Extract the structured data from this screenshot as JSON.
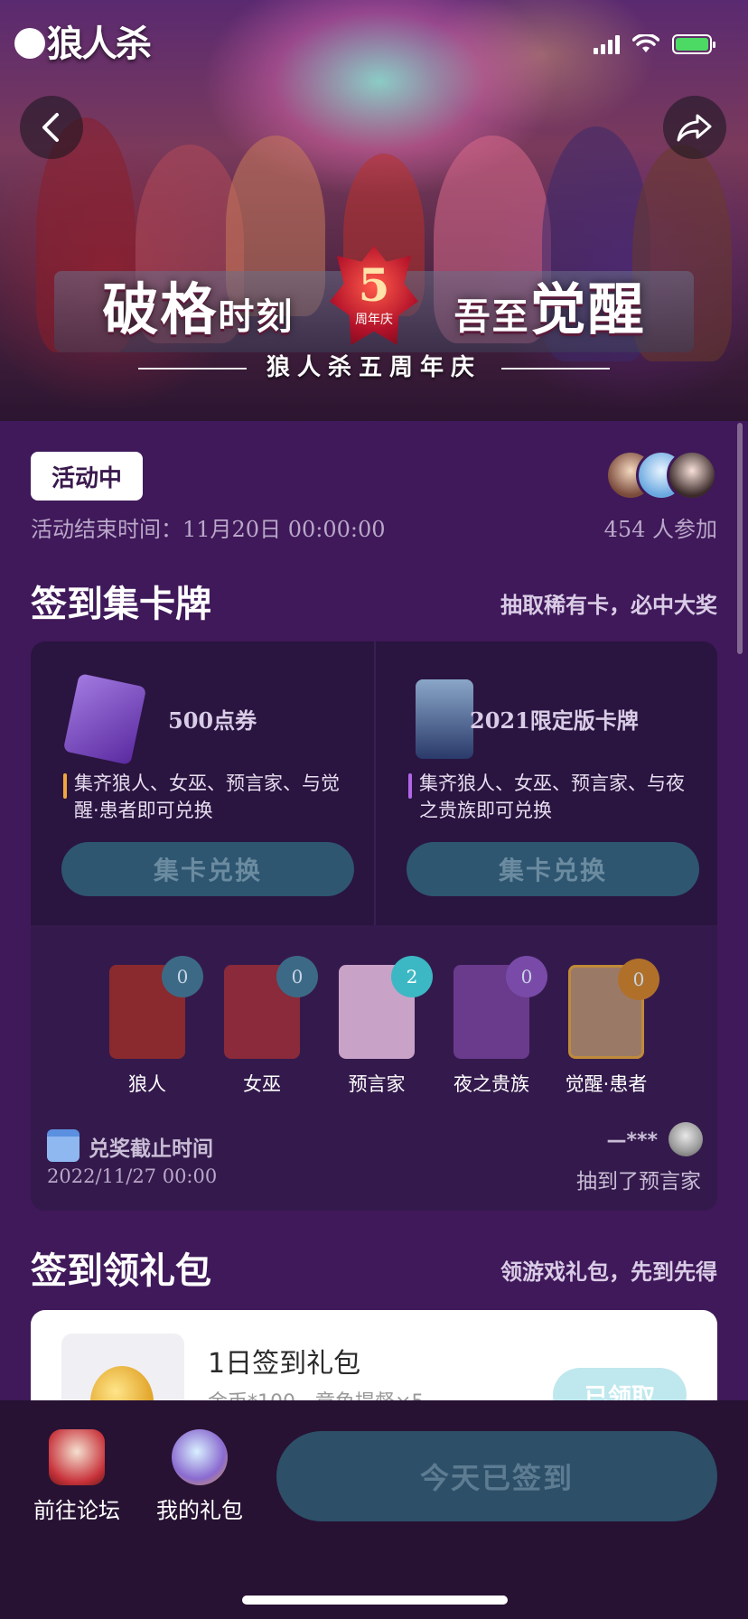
{
  "app": {
    "logo_text": "狼人杀"
  },
  "hero": {
    "title_left_big": "破格",
    "title_left_small": "时刻",
    "title_right_small": "吾至",
    "title_right_big": "觉醒",
    "badge_number": "5",
    "badge_label": "周年庆",
    "subtitle": "狼人杀五周年庆"
  },
  "activity": {
    "status": "活动中",
    "end_time_label": "活动结束时间：",
    "end_time_value": "11月20日 00:00:00",
    "participants": "454 人参加"
  },
  "card_section": {
    "title": "签到集卡牌",
    "subtitle": "抽取稀有卡，必中大奖",
    "rewards": [
      {
        "name": "500点券",
        "desc": "集齐狼人、女巫、预言家、与觉醒·患者即可兑换",
        "button": "集卡兑换"
      },
      {
        "name": "2021限定版卡牌",
        "desc": "集齐狼人、女巫、预言家、与夜之贵族即可兑换",
        "button": "集卡兑换"
      }
    ],
    "cards": [
      {
        "label": "狼人",
        "count": "0",
        "bg": "#8a2a2e",
        "badge": "#3c6a86"
      },
      {
        "label": "女巫",
        "count": "0",
        "bg": "#8a2a3a",
        "badge": "#3c6a86"
      },
      {
        "label": "预言家",
        "count": "2",
        "bg": "#c9a2c8",
        "badge": "#3cb8c4"
      },
      {
        "label": "夜之贵族",
        "count": "0",
        "bg": "#6a3a8c",
        "badge": "#7a4aa8"
      },
      {
        "label": "觉醒·患者",
        "count": "0",
        "bg": "#9a7a66",
        "badge": "#b0702a"
      }
    ],
    "deadline_label": "兑奖截止时间",
    "deadline_date": "2022/11/27 00:00",
    "winner_name": "—***",
    "winner_text": "抽到了预言家"
  },
  "gift_section": {
    "title": "签到领礼包",
    "subtitle": "领游戏礼包，先到先得",
    "items": [
      {
        "title": "1日签到礼包",
        "desc": "金币*100，章鱼提督×5",
        "button": "已领取"
      }
    ]
  },
  "bottom_bar": {
    "forum_label": "前往论坛",
    "gift_label": "我的礼包",
    "signin_label": "今天已签到"
  }
}
